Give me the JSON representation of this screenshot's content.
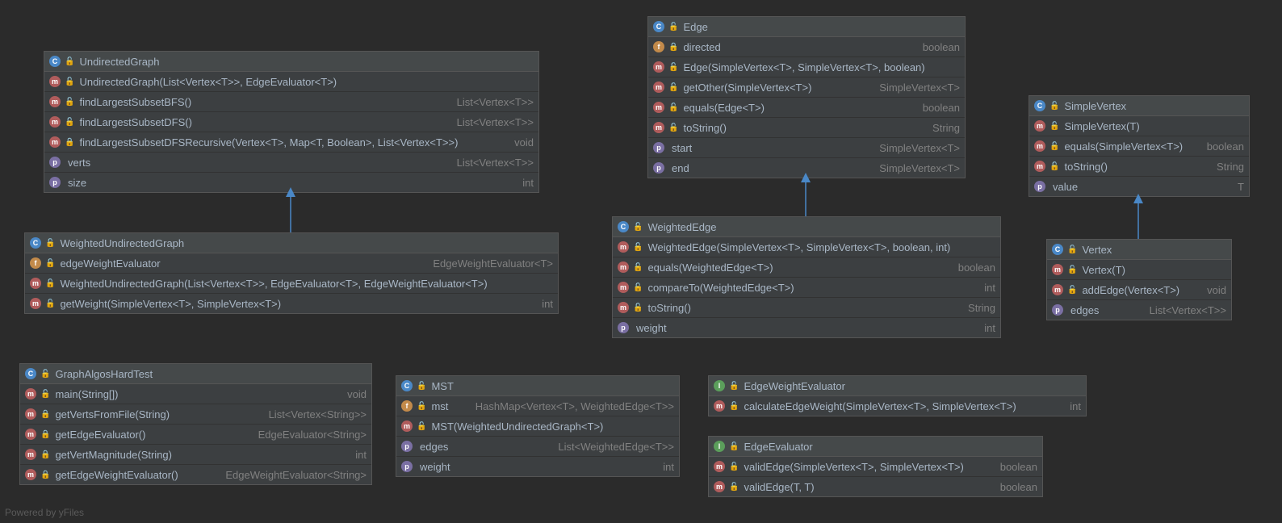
{
  "footer": "Powered by yFiles",
  "classes": {
    "UndirectedGraph": {
      "kind": "class",
      "name": "UndirectedGraph",
      "rows": [
        {
          "ic": "m",
          "vis": "open",
          "name": "UndirectedGraph(List<Vertex<T>>, EdgeEvaluator<T>)",
          "ret": ""
        },
        {
          "ic": "m",
          "vis": "open",
          "name": "findLargestSubsetBFS()",
          "ret": "List<Vertex<T>>"
        },
        {
          "ic": "m",
          "vis": "open",
          "name": "findLargestSubsetDFS()",
          "ret": "List<Vertex<T>>"
        },
        {
          "ic": "m",
          "vis": "lock",
          "name": "findLargestSubsetDFSRecursive(Vertex<T>, Map<T, Boolean>, List<Vertex<T>>)",
          "ret": "void"
        },
        {
          "ic": "p",
          "vis": "",
          "name": "verts",
          "ret": "List<Vertex<T>>"
        },
        {
          "ic": "p",
          "vis": "",
          "name": "size",
          "ret": "int"
        }
      ]
    },
    "WeightedUndirectedGraph": {
      "kind": "class",
      "name": "WeightedUndirectedGraph",
      "rows": [
        {
          "ic": "f",
          "vis": "open",
          "name": "edgeWeightEvaluator",
          "ret": "EdgeWeightEvaluator<T>"
        },
        {
          "ic": "m",
          "vis": "open",
          "name": "WeightedUndirectedGraph(List<Vertex<T>>, EdgeEvaluator<T>, EdgeWeightEvaluator<T>)",
          "ret": ""
        },
        {
          "ic": "m",
          "vis": "open",
          "name": "getWeight(SimpleVertex<T>, SimpleVertex<T>)",
          "ret": "int"
        }
      ]
    },
    "GraphAlgosHardTest": {
      "kind": "class",
      "name": "GraphAlgosHardTest",
      "rows": [
        {
          "ic": "m",
          "vis": "open",
          "name": "main(String[])",
          "ret": "void"
        },
        {
          "ic": "m",
          "vis": "lock",
          "name": "getVertsFromFile(String)",
          "ret": "List<Vertex<String>>"
        },
        {
          "ic": "m",
          "vis": "lock",
          "name": "getEdgeEvaluator()",
          "ret": "EdgeEvaluator<String>"
        },
        {
          "ic": "m",
          "vis": "lock",
          "name": "getVertMagnitude(String)",
          "ret": "int"
        },
        {
          "ic": "m",
          "vis": "lock",
          "name": "getEdgeWeightEvaluator()",
          "ret": "EdgeWeightEvaluator<String>"
        }
      ]
    },
    "MST": {
      "kind": "class",
      "name": "MST",
      "rows": [
        {
          "ic": "f",
          "vis": "open",
          "name": "mst",
          "ret": "HashMap<Vertex<T>, WeightedEdge<T>>"
        },
        {
          "ic": "m",
          "vis": "open",
          "name": "MST(WeightedUndirectedGraph<T>)",
          "ret": ""
        },
        {
          "ic": "p",
          "vis": "",
          "name": "edges",
          "ret": "List<WeightedEdge<T>>"
        },
        {
          "ic": "p",
          "vis": "",
          "name": "weight",
          "ret": "int"
        }
      ]
    },
    "Edge": {
      "kind": "class",
      "name": "Edge",
      "rows": [
        {
          "ic": "f",
          "vis": "lock",
          "name": "directed",
          "ret": "boolean"
        },
        {
          "ic": "m",
          "vis": "open",
          "name": "Edge(SimpleVertex<T>, SimpleVertex<T>, boolean)",
          "ret": ""
        },
        {
          "ic": "m",
          "vis": "open",
          "name": "getOther(SimpleVertex<T>)",
          "ret": "SimpleVertex<T>"
        },
        {
          "ic": "m",
          "vis": "open",
          "name": "equals(Edge<T>)",
          "ret": "boolean"
        },
        {
          "ic": "m",
          "vis": "open",
          "name": "toString()",
          "ret": "String"
        },
        {
          "ic": "p",
          "vis": "",
          "name": "start",
          "ret": "SimpleVertex<T>"
        },
        {
          "ic": "p",
          "vis": "",
          "name": "end",
          "ret": "SimpleVertex<T>"
        }
      ]
    },
    "WeightedEdge": {
      "kind": "class",
      "name": "WeightedEdge",
      "rows": [
        {
          "ic": "m",
          "vis": "open",
          "name": "WeightedEdge(SimpleVertex<T>, SimpleVertex<T>, boolean, int)",
          "ret": ""
        },
        {
          "ic": "m",
          "vis": "open",
          "name": "equals(WeightedEdge<T>)",
          "ret": "boolean"
        },
        {
          "ic": "m",
          "vis": "open",
          "name": "compareTo(WeightedEdge<T>)",
          "ret": "int"
        },
        {
          "ic": "m",
          "vis": "open",
          "name": "toString()",
          "ret": "String"
        },
        {
          "ic": "p",
          "vis": "",
          "name": "weight",
          "ret": "int"
        }
      ]
    },
    "SimpleVertex": {
      "kind": "class",
      "name": "SimpleVertex",
      "rows": [
        {
          "ic": "m",
          "vis": "open",
          "name": "SimpleVertex(T)",
          "ret": ""
        },
        {
          "ic": "m",
          "vis": "open",
          "name": "equals(SimpleVertex<T>)",
          "ret": "boolean"
        },
        {
          "ic": "m",
          "vis": "open",
          "name": "toString()",
          "ret": "String"
        },
        {
          "ic": "p",
          "vis": "",
          "name": "value",
          "ret": "T"
        }
      ]
    },
    "Vertex": {
      "kind": "class",
      "name": "Vertex",
      "rows": [
        {
          "ic": "m",
          "vis": "open",
          "name": "Vertex(T)",
          "ret": ""
        },
        {
          "ic": "m",
          "vis": "open",
          "name": "addEdge(Vertex<T>)",
          "ret": "void"
        },
        {
          "ic": "p",
          "vis": "",
          "name": "edges",
          "ret": "List<Vertex<T>>"
        }
      ]
    },
    "EdgeWeightEvaluator": {
      "kind": "interface",
      "name": "EdgeWeightEvaluator",
      "rows": [
        {
          "ic": "m",
          "vis": "open",
          "name": "calculateEdgeWeight(SimpleVertex<T>, SimpleVertex<T>)",
          "ret": "int"
        }
      ]
    },
    "EdgeEvaluator": {
      "kind": "interface",
      "name": "EdgeEvaluator",
      "rows": [
        {
          "ic": "m",
          "vis": "open",
          "name": "validEdge(SimpleVertex<T>, SimpleVertex<T>)",
          "ret": "boolean"
        },
        {
          "ic": "m",
          "vis": "open",
          "name": "validEdge(T, T)",
          "ret": "boolean"
        }
      ]
    }
  }
}
